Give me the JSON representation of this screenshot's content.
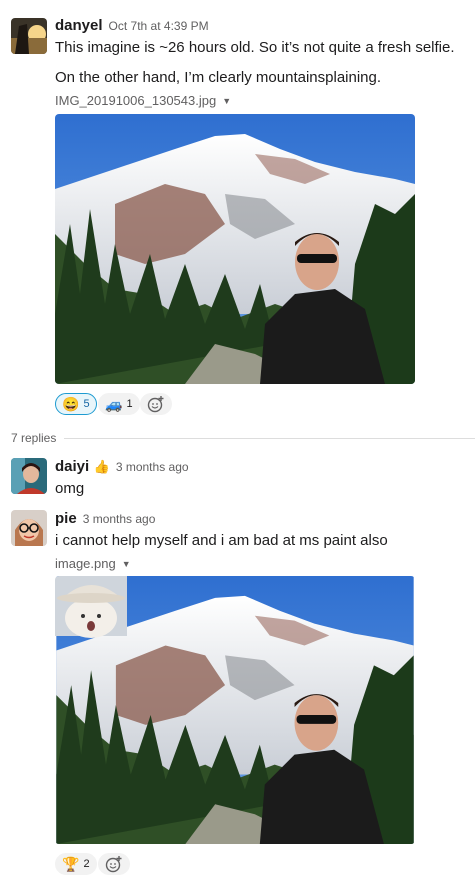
{
  "messages": [
    {
      "author": "danyel",
      "timestamp": "Oct 7th at 4:39 PM",
      "lines": [
        "This imagine is ~26 hours old. So it’s not quite a fresh selfie.",
        "On the other hand, I’m clearly mountainsplaining."
      ],
      "file": "IMG_20191006_130543.jpg",
      "reactions": [
        {
          "emoji": "😄",
          "count": "5",
          "active": true
        },
        {
          "emoji": "🚙",
          "count": "1",
          "active": false
        }
      ]
    }
  ],
  "thread": {
    "replies_label": "7 replies",
    "replies": [
      {
        "author": "daiyi",
        "badge": "👍",
        "timestamp": "3 months ago",
        "text": "omg"
      },
      {
        "author": "pie",
        "timestamp": "3 months ago",
        "text": "i cannot help myself and i am bad at ms paint also",
        "file": "image.png",
        "reactions": [
          {
            "emoji": "🏆",
            "count": "2"
          }
        ]
      }
    ]
  },
  "icons": {
    "file_caret": "▼",
    "add_reaction": "add-reaction-icon"
  },
  "colors": {
    "active_reaction_border": "#1d9bd1",
    "active_reaction_bg": "#e8f5fa",
    "timestamp": "#616061"
  }
}
